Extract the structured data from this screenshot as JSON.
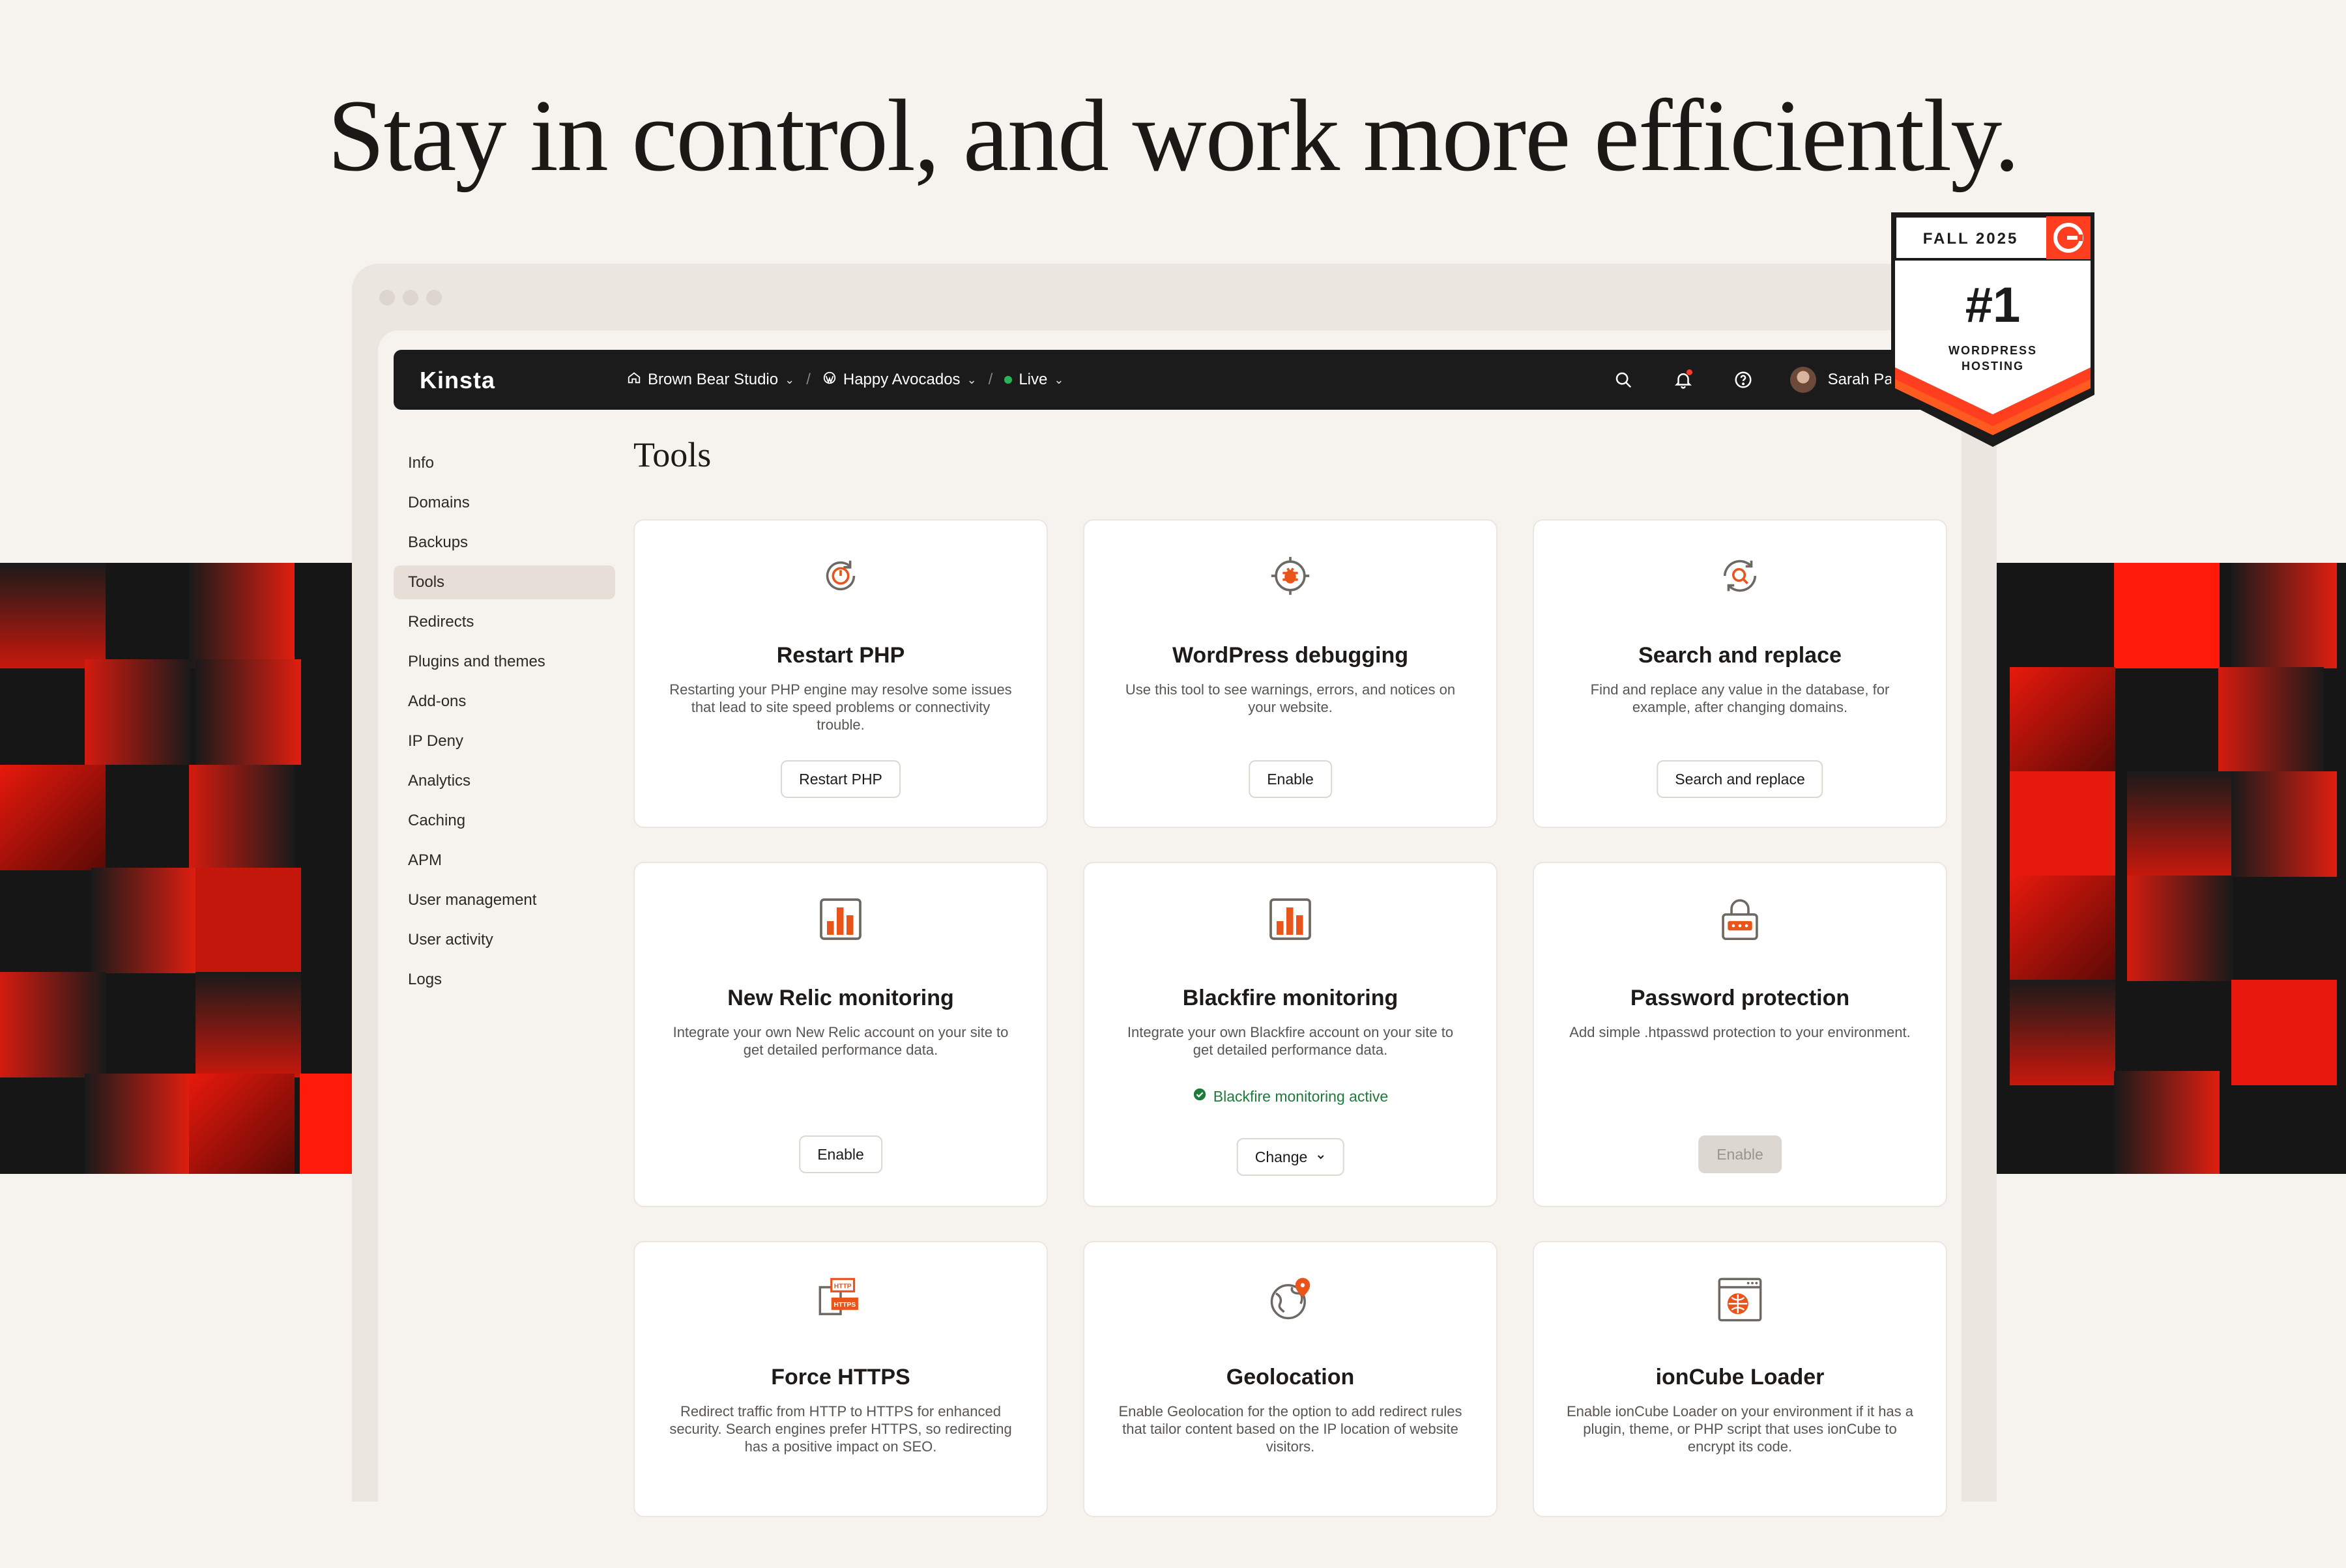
{
  "hero": {
    "title": "Stay in control, and work more efficiently."
  },
  "badge": {
    "season": "FALL 2025",
    "rank": "#1",
    "line1": "WORDPRESS",
    "line2": "HOSTING",
    "logo": "G2"
  },
  "topbar": {
    "logo": "Kinsta",
    "breadcrumbs": [
      {
        "icon": "home-icon",
        "label": "Brown Bear Studio"
      },
      {
        "icon": "wordpress-icon",
        "label": "Happy Avocados"
      },
      {
        "icon": "status-dot",
        "label": "Live"
      }
    ],
    "icons": [
      "search-icon",
      "bell-icon",
      "help-icon"
    ],
    "user": "Sarah Parker"
  },
  "sidebar": {
    "items": [
      {
        "label": "Info"
      },
      {
        "label": "Domains"
      },
      {
        "label": "Backups"
      },
      {
        "label": "Tools",
        "active": true
      },
      {
        "label": "Redirects"
      },
      {
        "label": "Plugins and themes"
      },
      {
        "label": "Add-ons"
      },
      {
        "label": "IP Deny"
      },
      {
        "label": "Analytics"
      },
      {
        "label": "Caching"
      },
      {
        "label": "APM"
      },
      {
        "label": "User management"
      },
      {
        "label": "User activity"
      },
      {
        "label": "Logs"
      }
    ]
  },
  "main": {
    "title": "Tools",
    "cards": [
      {
        "icon": "restart-icon",
        "title": "Restart PHP",
        "desc": "Restarting your PHP engine may resolve some issues that lead to site speed problems or connectivity trouble.",
        "button": "Restart PHP"
      },
      {
        "icon": "bug-icon",
        "title": "WordPress debugging",
        "desc": "Use this tool to see warnings, errors, and notices on your website.",
        "button": "Enable"
      },
      {
        "icon": "search-replace-icon",
        "title": "Search and replace",
        "desc": "Find and replace any value in the database, for example, after changing domains.",
        "button": "Search and replace"
      },
      {
        "icon": "chart-icon",
        "title": "New Relic monitoring",
        "desc": "Integrate your own New Relic account on your site to get detailed performance data.",
        "button": "Enable"
      },
      {
        "icon": "chart-icon",
        "title": "Blackfire monitoring",
        "desc": "Integrate your own Blackfire account on your site to get detailed performance data.",
        "status": "Blackfire monitoring active",
        "button": "Change"
      },
      {
        "icon": "lock-icon",
        "title": "Password protection",
        "desc": "Add simple .htpasswd protection to your environment.",
        "button": "Enable",
        "disabled": true
      },
      {
        "icon": "https-icon",
        "title": "Force HTTPS",
        "desc": "Redirect traffic from HTTP to HTTPS for enhanced security. Search engines prefer HTTPS, so redirecting has a positive impact on SEO."
      },
      {
        "icon": "globe-icon",
        "title": "Geolocation",
        "desc": "Enable Geolocation for the option to add redirect rules that tailor content based on the IP location of website visitors."
      },
      {
        "icon": "ioncube-icon",
        "title": "ionCube Loader",
        "desc": "Enable ionCube Loader on your environment if it has a plugin, theme, or PHP script that uses ionCube to encrypt its code."
      }
    ],
    "https_labels": {
      "http": "HTTP",
      "https": "HTTPS"
    }
  },
  "colors": {
    "accent": "#e8541a",
    "background": "#f6f3ef",
    "topbar": "#1b1b1b",
    "success": "#1e7a3a",
    "badge_red": "#ff3d1f"
  }
}
